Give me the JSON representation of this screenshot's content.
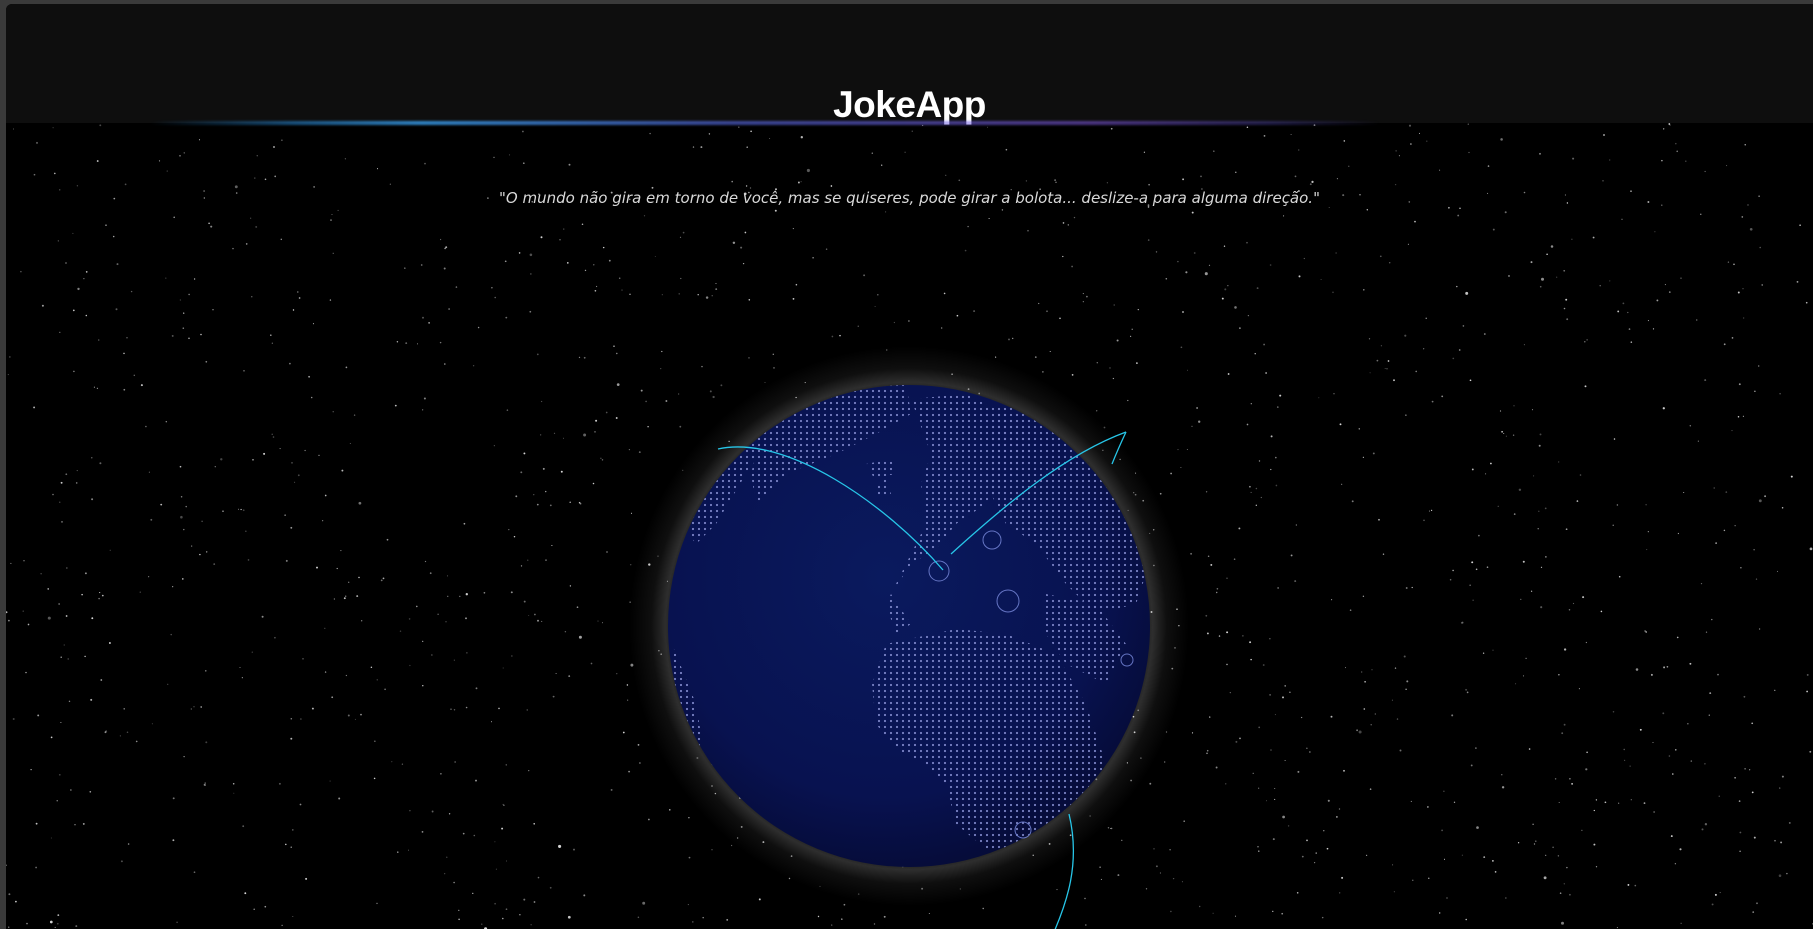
{
  "app": {
    "title": "JokeApp"
  },
  "quote": {
    "text": "\"O mundo não gira em torno de você, mas se quiseres, pode girar a bolota... deslize-a para alguma direção.\""
  },
  "globe": {
    "icon": "globe-icon",
    "description_visible": false
  },
  "colors": {
    "background": "#000000",
    "header": "#0e0e0e",
    "globe_fill": "#0b1350",
    "land_dots": "#8d96d9",
    "arc": "#27c6e8",
    "title": "#ffffff",
    "quote": "#d9d9d9"
  }
}
